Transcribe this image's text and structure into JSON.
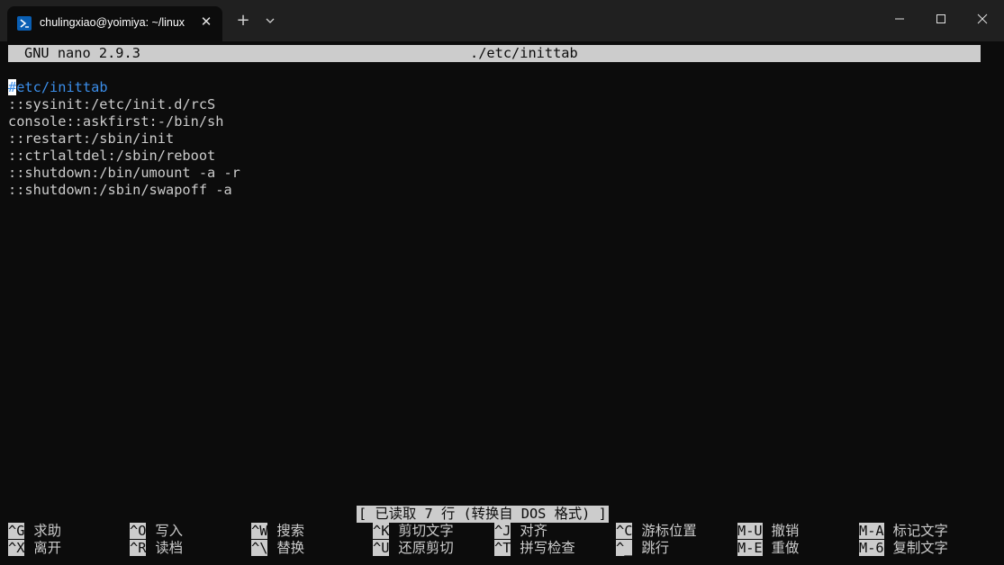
{
  "tab": {
    "title": "chulingxiao@yoimiya: ~/linux"
  },
  "nano": {
    "version": "GNU nano 2.9.3",
    "filename": "./etc/inittab"
  },
  "file_lines": [
    "#etc/inittab",
    "::sysinit:/etc/init.d/rcS",
    "console::askfirst:-/bin/sh",
    "::restart:/sbin/init",
    "::ctrlaltdel:/sbin/reboot",
    "::shutdown:/bin/umount -a -r",
    "::shutdown:/sbin/swapoff -a"
  ],
  "status_message": "[ 已读取 7 行 (转换自 DOS 格式) ]",
  "shortcuts": [
    {
      "key": "^G",
      "label": "求助"
    },
    {
      "key": "^O",
      "label": "写入"
    },
    {
      "key": "^W",
      "label": "搜索"
    },
    {
      "key": "^K",
      "label": "剪切文字"
    },
    {
      "key": "^J",
      "label": "对齐"
    },
    {
      "key": "^C",
      "label": "游标位置"
    },
    {
      "key": "M-U",
      "label": "撤销"
    },
    {
      "key": "M-A",
      "label": "标记文字"
    },
    {
      "key": "^X",
      "label": "离开"
    },
    {
      "key": "^R",
      "label": "读档"
    },
    {
      "key": "^\\",
      "label": "替换"
    },
    {
      "key": "^U",
      "label": "还原剪切"
    },
    {
      "key": "^T",
      "label": "拼写检查"
    },
    {
      "key": "^_",
      "label": "跳行"
    },
    {
      "key": "M-E",
      "label": "重做"
    },
    {
      "key": "M-6",
      "label": "复制文字"
    }
  ],
  "colors": {
    "terminal_bg": "#0c0c0c",
    "terminal_fg": "#cccccc",
    "titlebar_bg": "#202020",
    "comment_blue": "#3b8eea"
  },
  "icons": {
    "tab_icon": "powershell-icon",
    "close": "close-icon",
    "new_tab": "plus-icon",
    "dropdown": "chevron-down-icon",
    "minimize": "minimize-icon",
    "maximize": "maximize-icon",
    "window_close": "close-icon"
  }
}
